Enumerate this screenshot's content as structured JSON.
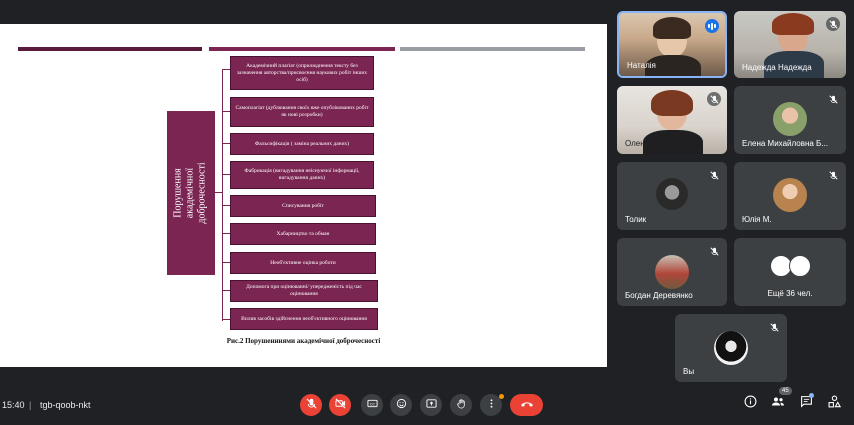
{
  "slide": {
    "vertical_title": "Порушення академічної доброчесності",
    "boxes": [
      "Академічний плагіат (оприлюднення тексту без зазначення авторства/присвоєння наукових робіт інших осіб)",
      "Самоплагіат (дублювання своїх вже опублікованих робіт як нові розробки)",
      "Фальсифікація ( заміна реальних даних)",
      "Фабрикація (вигадування неіснуючої інформації, вигадування даних)",
      "Списування робіт",
      "Хабарництво та обман",
      "Необ'єктивне оцінка роботи",
      "Допомога при оцінюванні/ упередженість під час оцінювання",
      "Вплив засобів здійснення необ'єктивного оцінювання"
    ],
    "caption": "Рис.2 Порушенннями академічної доброчесності"
  },
  "participants": [
    {
      "name": "Наталія",
      "state": "speaking"
    },
    {
      "name": "Надежда Надежда",
      "state": "muted"
    },
    {
      "name": "Олена Бісюк",
      "state": "muted"
    },
    {
      "name": "Елена Михайловна Б...",
      "state": "muted"
    },
    {
      "name": "Толик",
      "state": "muted"
    },
    {
      "name": "Юлія М.",
      "state": "muted"
    },
    {
      "name": "Богдан Деревянко",
      "state": "muted"
    },
    {
      "name": "Вы",
      "state": "muted"
    }
  ],
  "more": {
    "label": "Ещё 36 чел."
  },
  "meeting": {
    "time": "15:40",
    "separator": "|",
    "code": "tgb-qoob-nkt",
    "participant_count": "45"
  },
  "colors": {
    "accent": "#7a2552",
    "end_call": "#ea4335",
    "speaking": "#1a73e8",
    "tile": "#3c4043",
    "background": "#202124"
  },
  "controls": [
    "mic-off-icon",
    "camera-off-icon",
    "captions-icon",
    "emoji-icon",
    "present-icon",
    "raise-hand-icon",
    "more-options-icon",
    "end-call-icon"
  ],
  "right_controls": [
    "info-icon",
    "people-icon",
    "chat-icon",
    "activities-icon"
  ]
}
